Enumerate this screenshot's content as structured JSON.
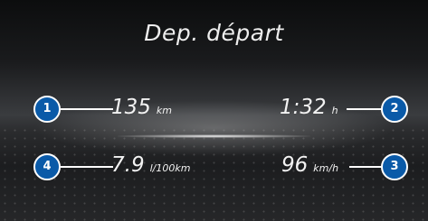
{
  "display": {
    "title": "Dep. départ"
  },
  "readouts": [
    {
      "callout": "1",
      "value": "135",
      "unit": "km"
    },
    {
      "callout": "2",
      "value": "1:32",
      "unit": "h"
    },
    {
      "callout": "3",
      "value": "96",
      "unit": "km/h"
    },
    {
      "callout": "4",
      "value": "7.9",
      "unit": "l/100km"
    }
  ],
  "colors": {
    "callout_fill": "#0a5aa8",
    "text": "#f2f2f2"
  }
}
